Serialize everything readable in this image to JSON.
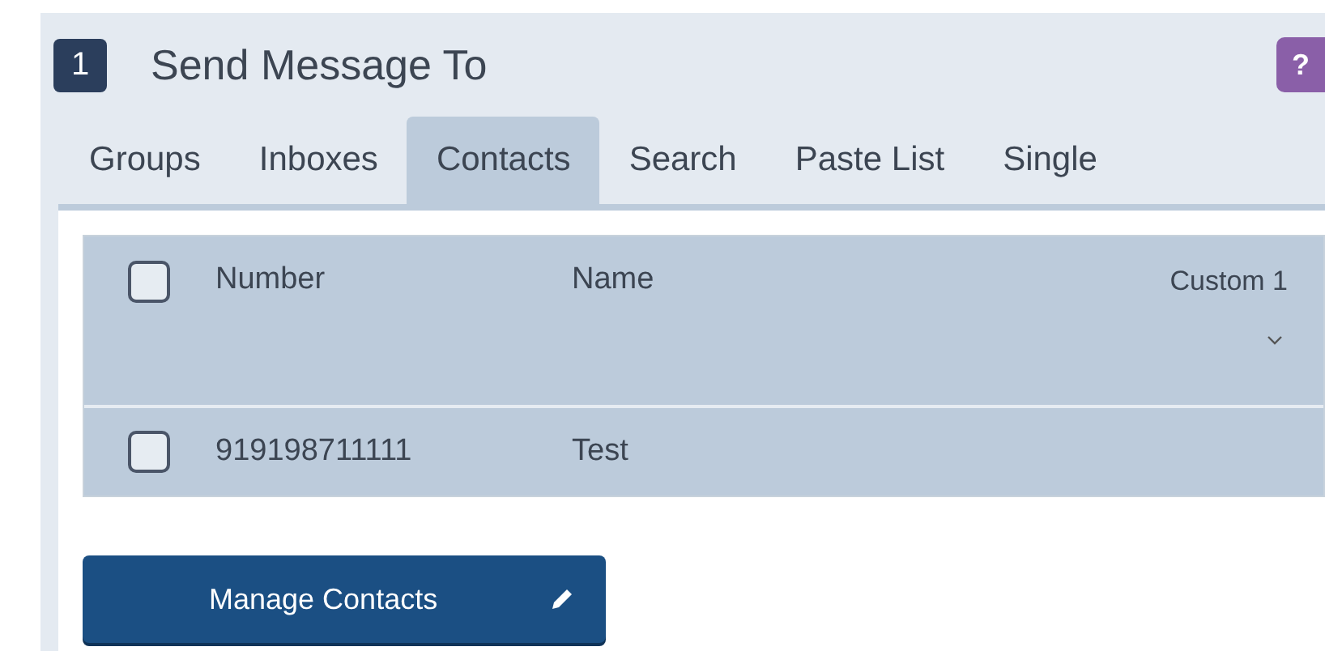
{
  "step": {
    "number": "1",
    "title": "Send Message To",
    "help": "?"
  },
  "tabs": [
    {
      "label": "Groups",
      "selected": false
    },
    {
      "label": "Inboxes",
      "selected": false
    },
    {
      "label": "Contacts",
      "selected": true
    },
    {
      "label": "Search",
      "selected": false
    },
    {
      "label": "Paste List",
      "selected": false
    },
    {
      "label": "Single",
      "selected": false
    }
  ],
  "table": {
    "header_checked": false,
    "columns": [
      "Number",
      "Name",
      "Custom 1"
    ],
    "rows": [
      {
        "checked": false,
        "cells": [
          "919198711111",
          "Test",
          ""
        ]
      }
    ]
  },
  "button": "Manage Contacts"
}
